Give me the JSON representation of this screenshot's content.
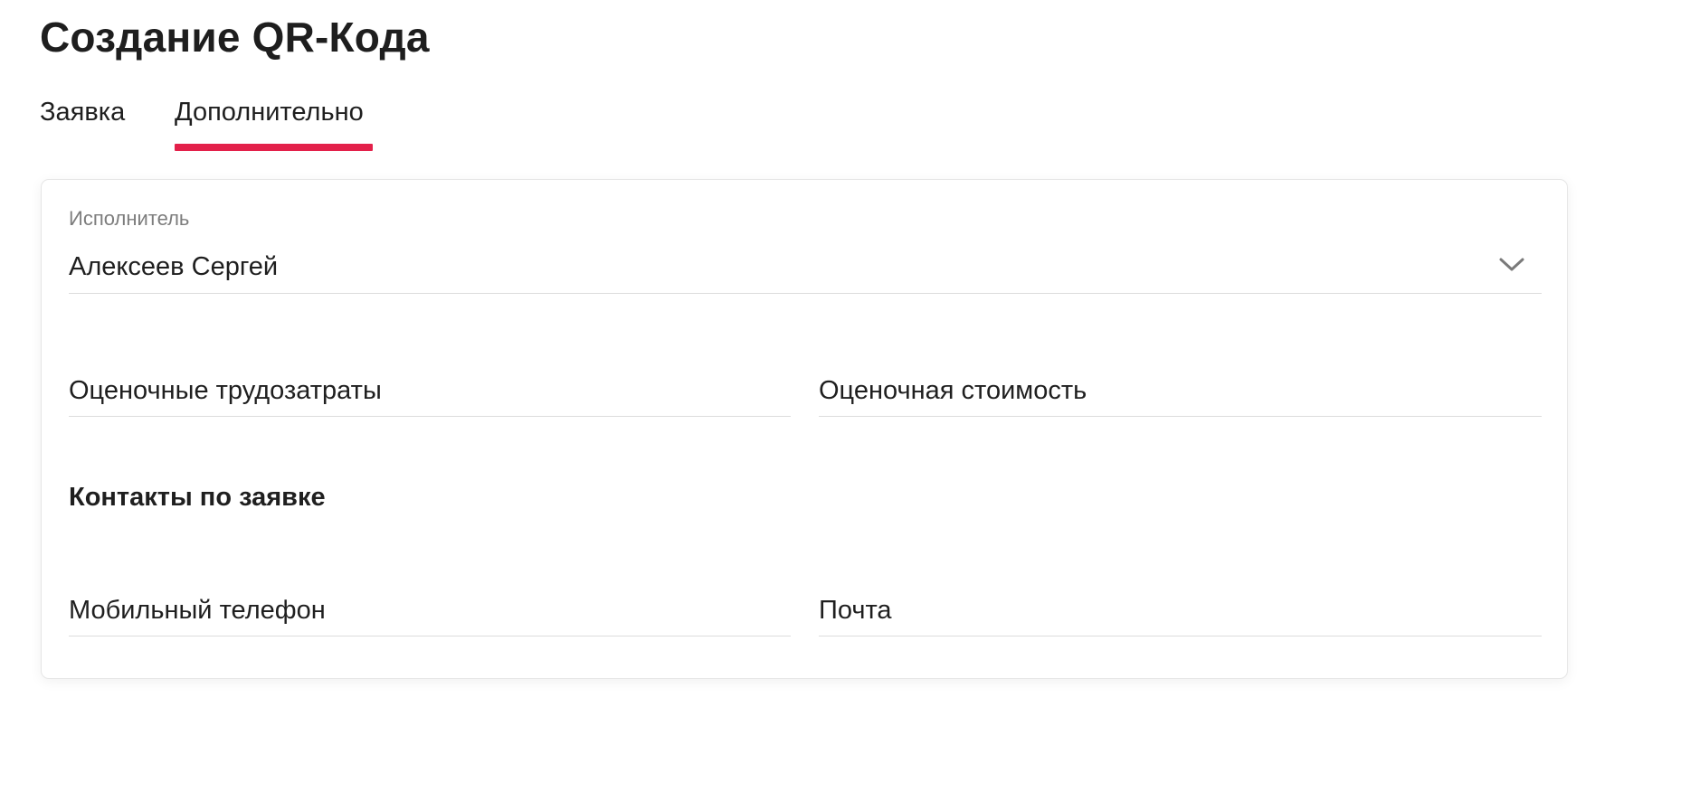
{
  "page": {
    "title": "Создание QR-Кода"
  },
  "tabs": [
    {
      "label": "Заявка",
      "active": false
    },
    {
      "label": "Дополнительно",
      "active": true
    }
  ],
  "colors": {
    "accent": "#e3204a",
    "text": "#1f1f1f",
    "muted": "#7d7d7d",
    "divider": "#dcdcdc"
  },
  "form": {
    "executor": {
      "label": "Исполнитель",
      "value": "Алексеев Сергей",
      "icon": "chevron-down-icon"
    },
    "estimated_effort": {
      "placeholder": "Оценочные трудозатраты"
    },
    "estimated_cost": {
      "placeholder": "Оценочная стоимость"
    },
    "contacts_section_title": "Контакты по заявке",
    "mobile_phone": {
      "placeholder": "Мобильный телефон"
    },
    "email": {
      "placeholder": "Почта"
    }
  }
}
